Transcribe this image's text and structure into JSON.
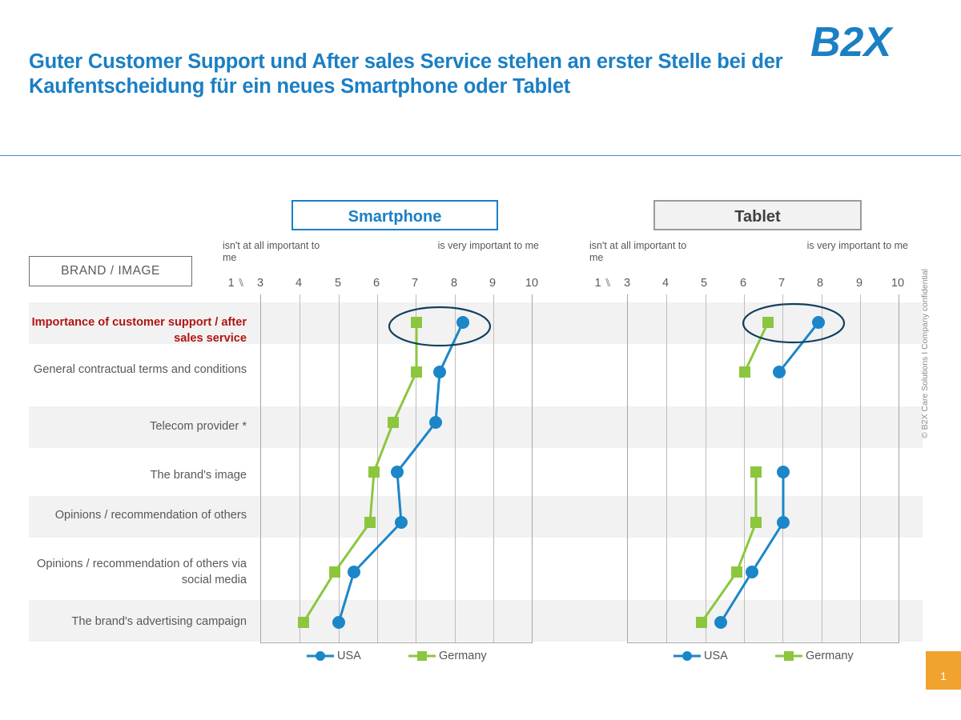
{
  "brand": {
    "logo_text": "B2X",
    "logo_color": "#1B7FC4"
  },
  "header": {
    "title": "Guter Customer Support und After sales Service stehen an erster Stelle bei der Kaufentscheidung für ein neues Smartphone oder Tablet",
    "title_color": "#1B7FC4"
  },
  "left_column": {
    "section_box_label": "BRAND / IMAGE"
  },
  "footer": {
    "confidentiality": "© B2X Care Solutions I Company confidential",
    "page_number": "1",
    "page_badge_color": "#F0A32E"
  },
  "legend": {
    "usa_label": "USA",
    "germany_label": "Germany",
    "usa_color": "#1B86C8",
    "germany_color": "#8CC63F"
  },
  "scale": {
    "low_label": "isn't at all important to me",
    "high_label_smartphone": "is very important to me",
    "high_label_tablet": "is very important to me",
    "break_symbol": "1 ⑊",
    "first_tick": "1",
    "ticks": [
      "3",
      "4",
      "5",
      "6",
      "7",
      "8",
      "9",
      "10"
    ]
  },
  "panels": {
    "smartphone_title": "Smartphone",
    "tablet_title": "Tablet"
  },
  "annotations": {
    "highlight_ellipse_color": "#14405E",
    "highlight_row_color": "#B01513"
  },
  "chart_data": {
    "type": "line",
    "title": "Importance of purchase decision criteria — Smartphone vs. Tablet",
    "xlabel": "",
    "ylabel": "",
    "xlim": [
      3,
      10
    ],
    "xticks": [
      3,
      4,
      5,
      6,
      7,
      8,
      9,
      10
    ],
    "grid": true,
    "legend_position": "bottom",
    "orientation": "horizontal",
    "categories": [
      "Importance of customer support / after sales service",
      "General contractual terms and conditions",
      "Telecom provider *",
      "The brand's image",
      "Opinions / recommendation of others",
      "Opinions / recommendation of others via social media",
      "The brand's advertising campaign"
    ],
    "panels": [
      {
        "name": "Smartphone",
        "series": [
          {
            "name": "USA",
            "color": "#1B86C8",
            "values": [
              8.2,
              7.6,
              7.5,
              6.5,
              6.6,
              5.4,
              5.0
            ]
          },
          {
            "name": "Germany",
            "color": "#8CC63F",
            "values": [
              7.0,
              7.0,
              6.4,
              5.9,
              5.8,
              4.9,
              4.1
            ]
          }
        ]
      },
      {
        "name": "Tablet",
        "series": [
          {
            "name": "USA",
            "color": "#1B86C8",
            "values": [
              7.9,
              6.9,
              null,
              7.0,
              7.0,
              6.2,
              5.5
            ]
          },
          {
            "name": "Germany",
            "color": "#8CC63F",
            "values": [
              6.6,
              6.0,
              null,
              6.3,
              6.3,
              5.8,
              4.9
            ]
          }
        ]
      }
    ],
    "highlighted_category": "Importance of customer support / after sales service"
  }
}
